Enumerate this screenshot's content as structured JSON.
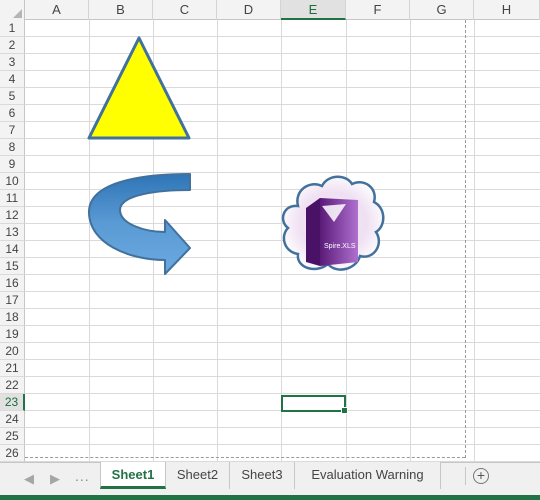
{
  "columns": [
    "A",
    "B",
    "C",
    "D",
    "E",
    "F",
    "G",
    "H"
  ],
  "active_column": "E",
  "rows": [
    "1",
    "2",
    "3",
    "4",
    "5",
    "6",
    "7",
    "8",
    "9",
    "10",
    "11",
    "12",
    "13",
    "14",
    "15",
    "16",
    "17",
    "18",
    "19",
    "20",
    "21",
    "22",
    "23",
    "24",
    "25",
    "26"
  ],
  "active_row": "23",
  "selected_cell": "E23",
  "shapes": {
    "triangle": {
      "fill": "#ffff00",
      "stroke": "#41719c"
    },
    "u_turn_arrow": {
      "fill": "#5b9bd5",
      "stroke": "#41719c"
    },
    "cloud_image": {
      "fill": "#ffffff",
      "stroke": "#41719c",
      "box_text": "Spire.XLS"
    }
  },
  "sheet_tabs": [
    {
      "label": "Sheet1",
      "active": true
    },
    {
      "label": "Sheet2",
      "active": false
    },
    {
      "label": "Sheet3",
      "active": false
    },
    {
      "label": "Evaluation Warning",
      "active": false
    }
  ],
  "tab_nav": {
    "prev_icon": "◀",
    "next_icon": "▶",
    "ellipsis": "...",
    "add_sheet": "+"
  },
  "colors": {
    "excel_green": "#217346",
    "grid": "#dadada",
    "header_bg": "#f3f3f3"
  }
}
